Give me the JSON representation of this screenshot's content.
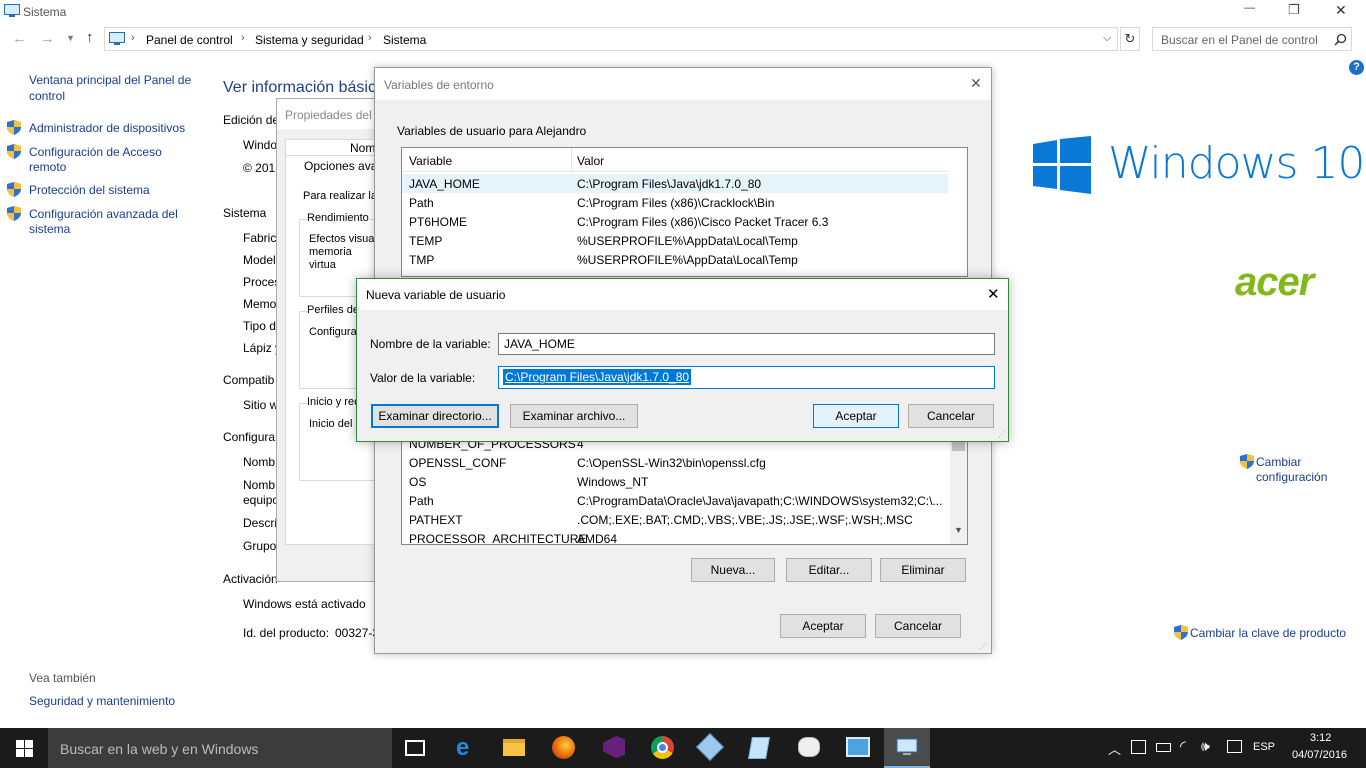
{
  "window": {
    "title": "Sistema",
    "minimize_glyph": "—",
    "maximize_glyph": "❐",
    "close_glyph": "✕"
  },
  "address": {
    "crumbs": [
      "Panel de control",
      "Sistema y seguridad",
      "Sistema"
    ],
    "search_placeholder": "Buscar en el Panel de control"
  },
  "sidebar": {
    "home_label": "Ventana principal del Panel de control",
    "items": [
      {
        "label": "Administrador de dispositivos",
        "icon": "shield-icon"
      },
      {
        "label": "Configuración de Acceso remoto",
        "icon": "shield-icon"
      },
      {
        "label": "Protección del sistema",
        "icon": "shield-icon"
      },
      {
        "label": "Configuración avanzada del sistema",
        "icon": "shield-icon"
      }
    ],
    "see_also_label": "Vea también",
    "see_also_link": "Seguridad y mantenimiento"
  },
  "main": {
    "heading": "Ver información básica",
    "edition_label": "Edición de",
    "windo_label": "Windo",
    "copyright_label": "© 201",
    "sistema_label": "Sistema",
    "sistema_rows": [
      "Fabric",
      "Model",
      "Proces",
      "Memo",
      "Tipo d",
      "Lápiz y"
    ],
    "compat_label": "Compatib",
    "sitio_label": "Sitio w",
    "config_label": "Configura",
    "config_rows": [
      "Nomb",
      "Nomb equipo",
      "Descri",
      "Grupo"
    ],
    "activation_label": "Activación",
    "activated_text": "Windows está activado",
    "product_id_label": "Id. del producto:",
    "product_id_value": "00327-3",
    "change_settings": "Cambiar configuración",
    "change_key": "Cambiar la clave de producto",
    "windows_logo_text": "Windows 10",
    "acer_logo_text": "acer"
  },
  "props_dialog": {
    "title": "Propiedades del s",
    "tab_label": "Nomb",
    "opciones_label": "Opciones avan",
    "para_label": "Para realizar la m",
    "rendimiento_label": "Rendimiento",
    "rendimiento_text": "Efectos visual memoria virtua",
    "perfiles_label": "Perfiles de",
    "configur_label": "Configurac",
    "inicio_label": "Inicio y rec",
    "inicio_text": "Inicio del s"
  },
  "env_dialog": {
    "title": "Variables de entorno",
    "user_vars_label": "Variables de usuario para Alejandro",
    "col_variable": "Variable",
    "col_value": "Valor",
    "user_vars": [
      {
        "name": "JAVA_HOME",
        "value": "C:\\Program Files\\Java\\jdk1.7.0_80"
      },
      {
        "name": "Path",
        "value": "C:\\Program Files (x86)\\Cracklock\\Bin"
      },
      {
        "name": "PT6HOME",
        "value": "C:\\Program Files (x86)\\Cisco Packet Tracer 6.3"
      },
      {
        "name": "TEMP",
        "value": "%USERPROFILE%\\AppData\\Local\\Temp"
      },
      {
        "name": "TMP",
        "value": "%USERPROFILE%\\AppData\\Local\\Temp"
      }
    ],
    "system_vars": [
      {
        "name": "NUMBER_OF_PROCESSORS",
        "value": "4"
      },
      {
        "name": "OPENSSL_CONF",
        "value": "C:\\OpenSSL-Win32\\bin\\openssl.cfg"
      },
      {
        "name": "OS",
        "value": "Windows_NT"
      },
      {
        "name": "Path",
        "value": "C:\\ProgramData\\Oracle\\Java\\javapath;C:\\WINDOWS\\system32;C:\\..."
      },
      {
        "name": "PATHEXT",
        "value": ".COM;.EXE;.BAT;.CMD;.VBS;.VBE;.JS;.JSE;.WSF;.WSH;.MSC"
      },
      {
        "name": "PROCESSOR_ARCHITECTURE",
        "value": "AMD64"
      }
    ],
    "new_button": "Nueva...",
    "edit_button": "Editar...",
    "delete_button": "Eliminar",
    "ok_button": "Aceptar",
    "cancel_button": "Cancelar"
  },
  "new_var_dialog": {
    "title": "Nueva variable de usuario",
    "name_label": "Nombre de la variable:",
    "name_value": "JAVA_HOME",
    "value_label": "Valor de la variable:",
    "value_value": "C:\\Program Files\\Java\\jdk1.7.0_80",
    "browse_dir_button": "Examinar directorio...",
    "browse_file_button": "Examinar archivo...",
    "ok_button": "Aceptar",
    "cancel_button": "Cancelar"
  },
  "taskbar": {
    "search_placeholder": "Buscar en la web y en Windows",
    "lang": "ESP",
    "time": "3:12",
    "date": "04/07/2016"
  },
  "colors": {
    "accent": "#0078d7",
    "taskbar": "#1b1b1b",
    "acer_green": "#83b81a",
    "dialog_border_green": "#2e8b3e"
  }
}
